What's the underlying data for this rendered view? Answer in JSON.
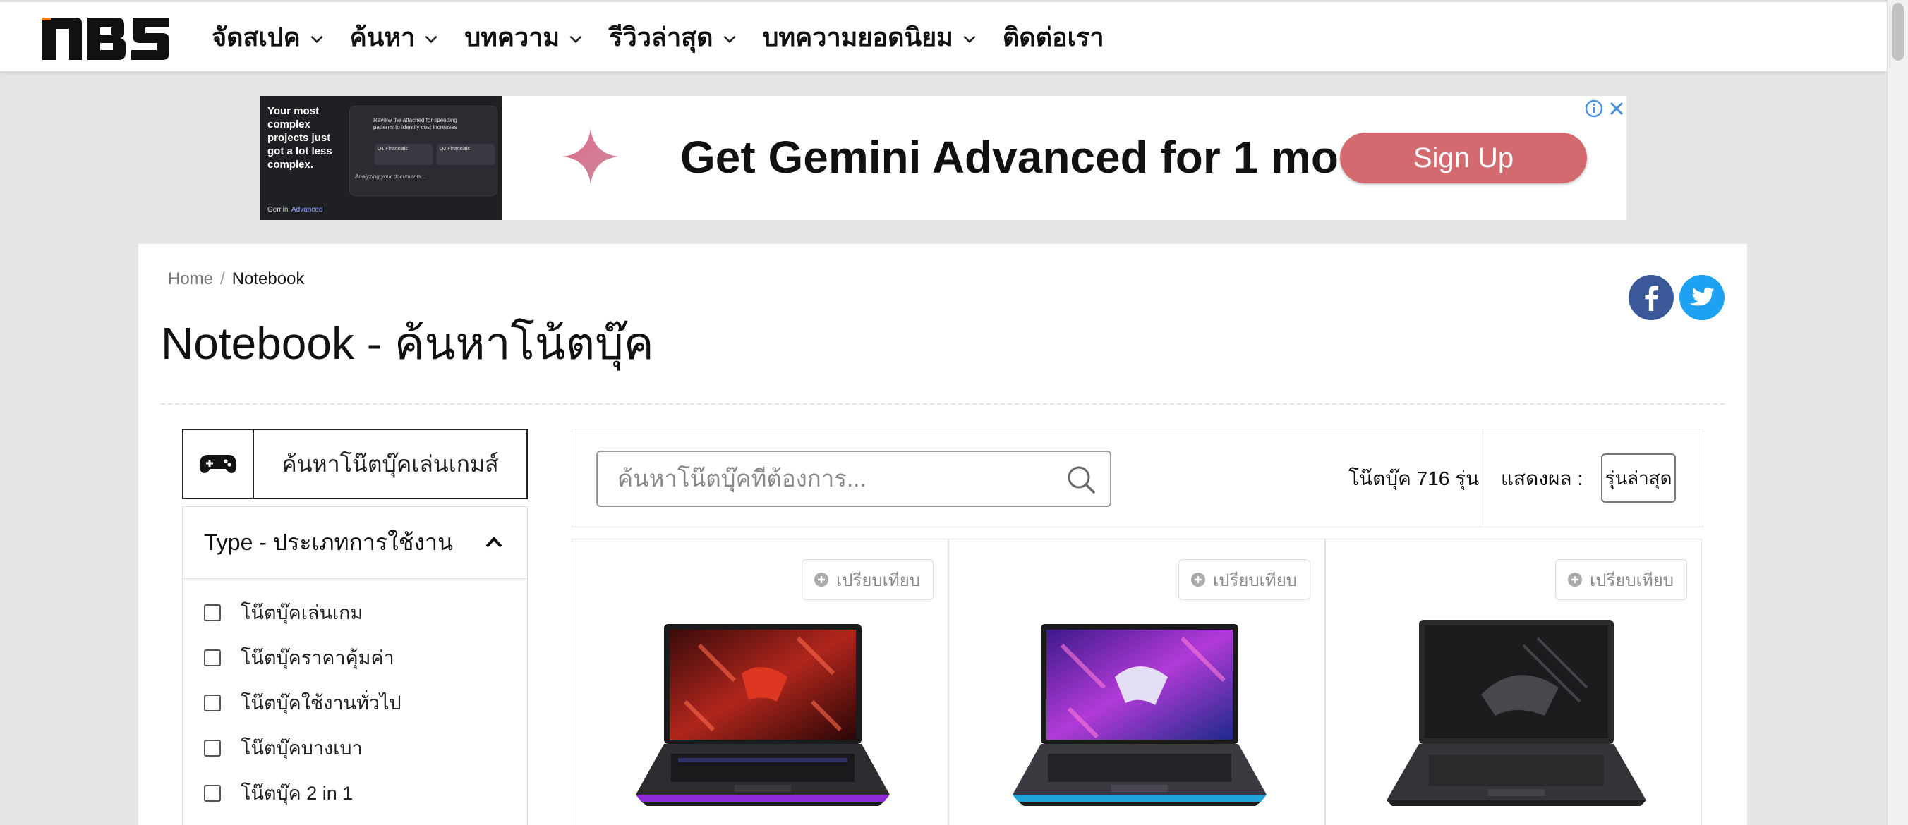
{
  "nav": {
    "logo_text": "NBS",
    "items": [
      {
        "label": "จัดสเปค",
        "has_dropdown": true
      },
      {
        "label": "ค้นหา",
        "has_dropdown": true
      },
      {
        "label": "บทความ",
        "has_dropdown": true
      },
      {
        "label": "รีวิวล่าสุด",
        "has_dropdown": true
      },
      {
        "label": "บทความยอดนิยม",
        "has_dropdown": true
      },
      {
        "label": "ติดต่อเรา",
        "has_dropdown": false
      }
    ]
  },
  "ad": {
    "thumb_text": "Your most complex projects just got a lot less complex.",
    "thumb_panel_text": "Review the attached for spending patterns to identify cost increases",
    "thumb_chip_1": "Q1 Financials",
    "thumb_chip_2": "Q2 Financials",
    "thumb_analyzing": "Analyzing your documents...",
    "thumb_brand": "Gemini",
    "thumb_brand_accent": "Advanced",
    "headline": "Get Gemini Advanced for 1 mo",
    "cta": "Sign Up",
    "brand_color": "#d36a70"
  },
  "breadcrumb": {
    "home": "Home",
    "separator": "/",
    "current": "Notebook"
  },
  "page": {
    "title": "Notebook - ค้นหาโน้ตบุ๊ค"
  },
  "share": {
    "facebook_color": "#3b5998",
    "twitter_color": "#1da1f2"
  },
  "sidebar": {
    "game_button_label": "ค้นหาโน๊ตบุ๊คเล่นเกมส์",
    "filter_title": "Type - ประเภทการใช้งาน",
    "options": [
      {
        "label": "โน๊ตบุ๊คเล่นเกม",
        "checked": false
      },
      {
        "label": "โน๊ตบุ๊คราคาคุ้มค่า",
        "checked": false
      },
      {
        "label": "โน๊ตบุ๊คใช้งานทั่วไป",
        "checked": false
      },
      {
        "label": "โน๊ตบุ๊คบางเบา",
        "checked": false
      },
      {
        "label": "โน๊ตบุ๊ค 2 in 1",
        "checked": false
      }
    ]
  },
  "toolbar": {
    "search_placeholder": "ค้นหาโน๊ตบุ๊คที่ต้องการ...",
    "count_text": "โน๊ตบุ๊ค 716 รุ่น",
    "sort_label": "แสดงผล :",
    "sort_value": "รุ่นล่าสุด"
  },
  "products": [
    {
      "compare_label": "เปรียบเทียบ",
      "screen_theme": "red"
    },
    {
      "compare_label": "เปรียบเทียบ",
      "screen_theme": "purple"
    },
    {
      "compare_label": "เปรียบเทียบ",
      "screen_theme": "dark"
    }
  ]
}
